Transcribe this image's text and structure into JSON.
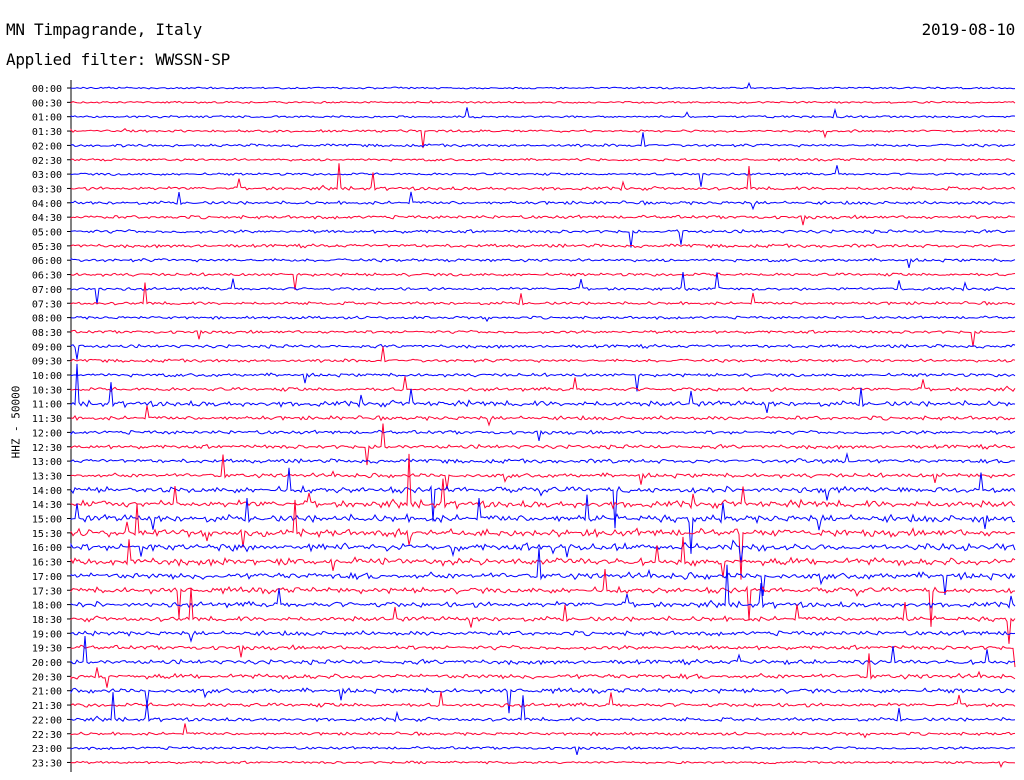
{
  "header": {
    "station": "MN Timpagrande, Italy",
    "date": "2019-08-10",
    "filter": "Applied filter: WWSSN-SP"
  },
  "chart_data": {
    "type": "line",
    "title": "MN Timpagrande, Italy",
    "subtitle": "Applied filter: WWSSN-SP",
    "ylabel": "HHZ - 50000",
    "row_labels": [
      "00:00",
      "00:30",
      "01:00",
      "01:30",
      "02:00",
      "02:30",
      "03:00",
      "03:30",
      "04:00",
      "04:30",
      "05:00",
      "05:30",
      "06:00",
      "06:30",
      "07:00",
      "07:30",
      "08:00",
      "08:30",
      "09:00",
      "09:30",
      "10:00",
      "10:30",
      "11:00",
      "11:30",
      "12:00",
      "12:30",
      "13:00",
      "13:30",
      "14:00",
      "14:30",
      "15:00",
      "15:30",
      "16:00",
      "16:30",
      "17:00",
      "17:30",
      "18:00",
      "18:30",
      "19:00",
      "19:30",
      "20:00",
      "20:30",
      "21:00",
      "21:30",
      "22:00",
      "22:30",
      "23:00",
      "23:30"
    ],
    "series": [
      {
        "color": "#0000ff"
      },
      {
        "color": "#ff0033"
      }
    ],
    "activity": [
      0.1,
      0.1,
      0.15,
      0.2,
      0.25,
      0.2,
      0.2,
      0.35,
      0.35,
      0.35,
      0.35,
      0.35,
      0.3,
      0.3,
      0.3,
      0.3,
      0.25,
      0.3,
      0.35,
      0.3,
      0.35,
      0.4,
      0.7,
      0.45,
      0.4,
      0.45,
      0.45,
      0.5,
      0.8,
      0.95,
      1.0,
      1.0,
      1.0,
      1.0,
      0.85,
      0.75,
      0.7,
      0.6,
      0.55,
      0.5,
      0.55,
      0.6,
      0.55,
      0.45,
      0.4,
      0.3,
      0.25,
      0.2
    ]
  }
}
